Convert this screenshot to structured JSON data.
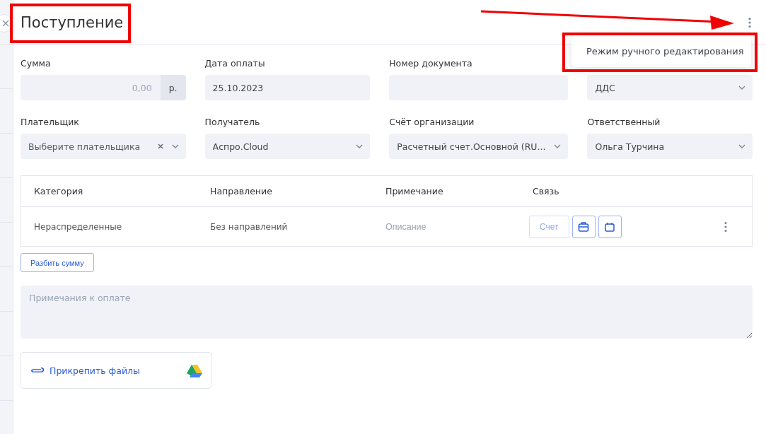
{
  "header": {
    "title": "Поступление"
  },
  "menu": {
    "items": [
      {
        "label": "Режим ручного редактирования"
      }
    ]
  },
  "fields": [
    {
      "kind": "amount",
      "label": "Сумма",
      "placeholder": "0,00",
      "suffix": "р."
    },
    {
      "kind": "text",
      "label": "Дата оплаты",
      "value": "25.10.2023"
    },
    {
      "kind": "text",
      "label": "Номер документа"
    },
    {
      "kind": "select",
      "value": "ДДС"
    },
    {
      "kind": "select",
      "label": "Плательщик",
      "placeholder": "Выберите плательщика",
      "clearable": true
    },
    {
      "kind": "select",
      "label": "Получатель",
      "value": "Аспро.Cloud"
    },
    {
      "kind": "select",
      "label": "Счёт организации",
      "value": "Расчетный счет.Основной (RU..."
    },
    {
      "kind": "select",
      "label": "Ответственный",
      "value": "Ольга Турчина"
    }
  ],
  "table": {
    "columns": [
      "Категория",
      "Направление",
      "Примечание",
      "Связь"
    ],
    "rows": [
      {
        "category": "Нераспределенные",
        "direction": "Без направлений",
        "note_placeholder": "Описание",
        "link_button": "Счет"
      }
    ]
  },
  "split_button": "Разбить сумму",
  "notes": {
    "placeholder": "Примечания к оплате"
  },
  "attach": {
    "label": "Прикрепить файлы"
  }
}
